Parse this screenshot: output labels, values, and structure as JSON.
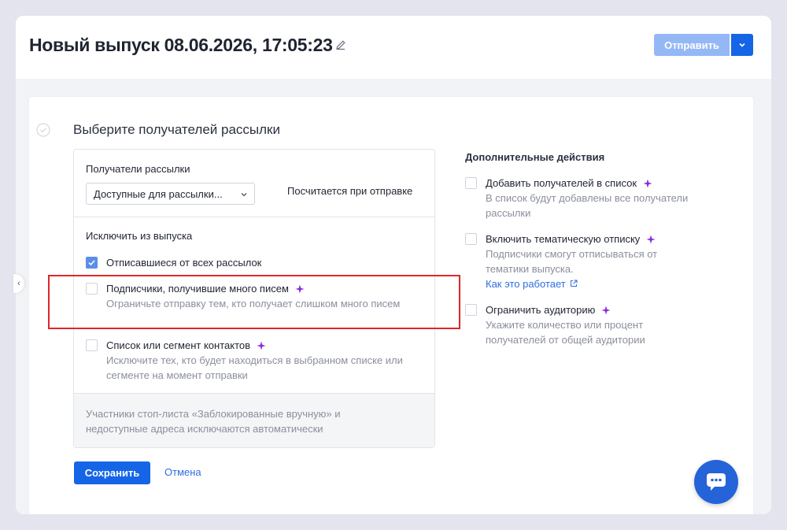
{
  "header": {
    "title": "Новый выпуск 08.06.2026, 17:05:23",
    "send_label": "Отправить"
  },
  "step": {
    "title": "Выберите получателей рассылки"
  },
  "recipients": {
    "label": "Получатели рассылки",
    "select_value": "Доступные для рассылки...",
    "calc_note": "Посчитается при отправке"
  },
  "exclude": {
    "title": "Исключить из выпуска",
    "options": [
      {
        "label": "Отписавшиеся от всех рассылок",
        "checked": true
      },
      {
        "label": "Подписчики, получившие много писем",
        "desc": "Ограничьте отправку тем, кто получает слишком много писем",
        "checked": false
      },
      {
        "label": "Список или сегмент контактов",
        "desc": "Исключите тех, кто будет находиться в выбранном списке или сегменте на момент отправки",
        "checked": false
      }
    ],
    "footer_note": "Участники стоп-листа «Заблокированные вручную» и недоступные адреса исключаются автоматически"
  },
  "additional": {
    "title": "Дополнительные действия",
    "options": [
      {
        "label": "Добавить получателей в список",
        "desc": "В список будут добавлены все получатели рассылки"
      },
      {
        "label": "Включить тематическую отписку",
        "desc": "Подписчики смогут отписываться от тематики выпуска.",
        "link": "Как это работает"
      },
      {
        "label": "Ограничить аудиторию",
        "desc": "Укажите количество или процент получателей от общей аудитории"
      }
    ]
  },
  "actions": {
    "save_label": "Сохранить",
    "cancel_label": "Отмена"
  },
  "colors": {
    "primary": "#1565e6",
    "primary_disabled": "#94b8f5",
    "checkbox_checked": "#5b8ee8",
    "sparkle": "#8a2be2",
    "highlight_box": "#e0262b"
  }
}
